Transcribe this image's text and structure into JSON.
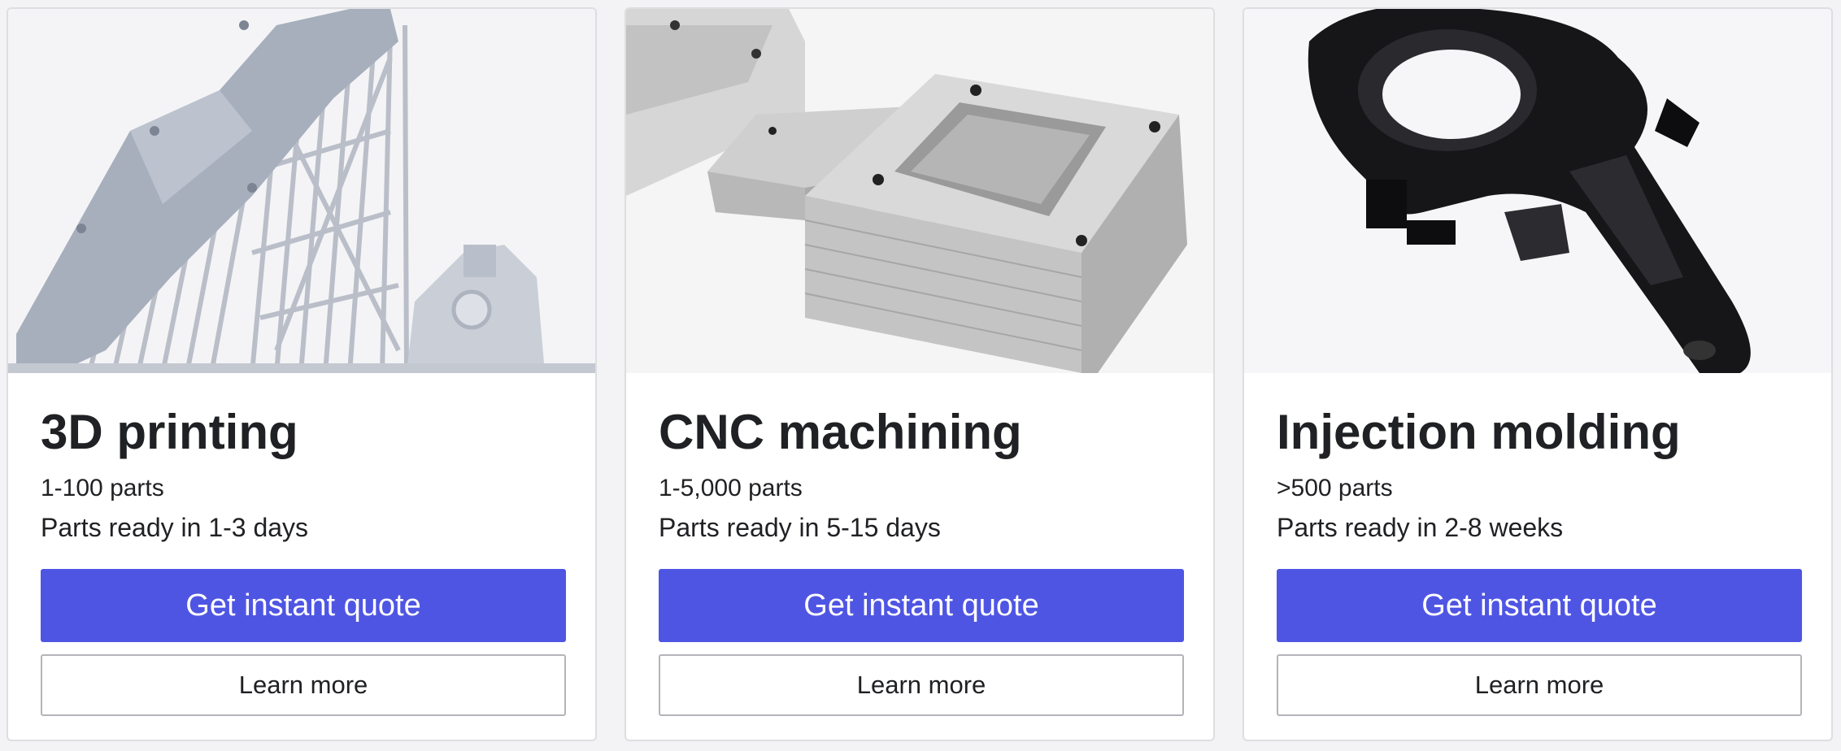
{
  "cards": [
    {
      "title": "3D printing",
      "quantity": "1-100 parts",
      "lead_time": "Parts ready in 1-3 days",
      "quote_label": "Get instant quote",
      "learn_label": "Learn more",
      "image": "3d-printed-part-with-supports"
    },
    {
      "title": "CNC machining",
      "quantity": "1-5,000 parts",
      "lead_time": "Parts ready in 5-15 days",
      "quote_label": "Get instant quote",
      "learn_label": "Learn more",
      "image": "machined-aluminum-blocks"
    },
    {
      "title": "Injection molding",
      "quantity": ">500 parts",
      "lead_time": "Parts ready in 2-8 weeks",
      "quote_label": "Get instant quote",
      "learn_label": "Learn more",
      "image": "black-molded-plastic-part"
    }
  ],
  "colors": {
    "primary_button": "#4f55e3",
    "text": "#202124",
    "card_border": "#dedee2",
    "outline_button_border": "#b4b4ba"
  }
}
